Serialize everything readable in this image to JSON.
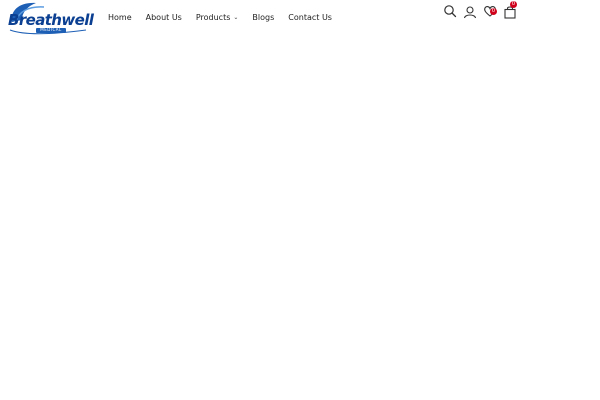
{
  "brand": {
    "name": "Breathwell",
    "subtitle": "MEDICAL",
    "color": "#0b3f91"
  },
  "nav": {
    "items": [
      {
        "label": "Home"
      },
      {
        "label": "About Us"
      },
      {
        "label": "Products",
        "has_dropdown": true
      },
      {
        "label": "Blogs"
      },
      {
        "label": "Contact Us"
      }
    ]
  },
  "actions": {
    "search_icon": "search-icon",
    "account_icon": "user-icon",
    "wishlist_icon": "heart-icon",
    "wishlist_count": "0",
    "cart_icon": "shopping-bag-icon",
    "cart_count": "0",
    "badge_color": "#d0021b"
  }
}
